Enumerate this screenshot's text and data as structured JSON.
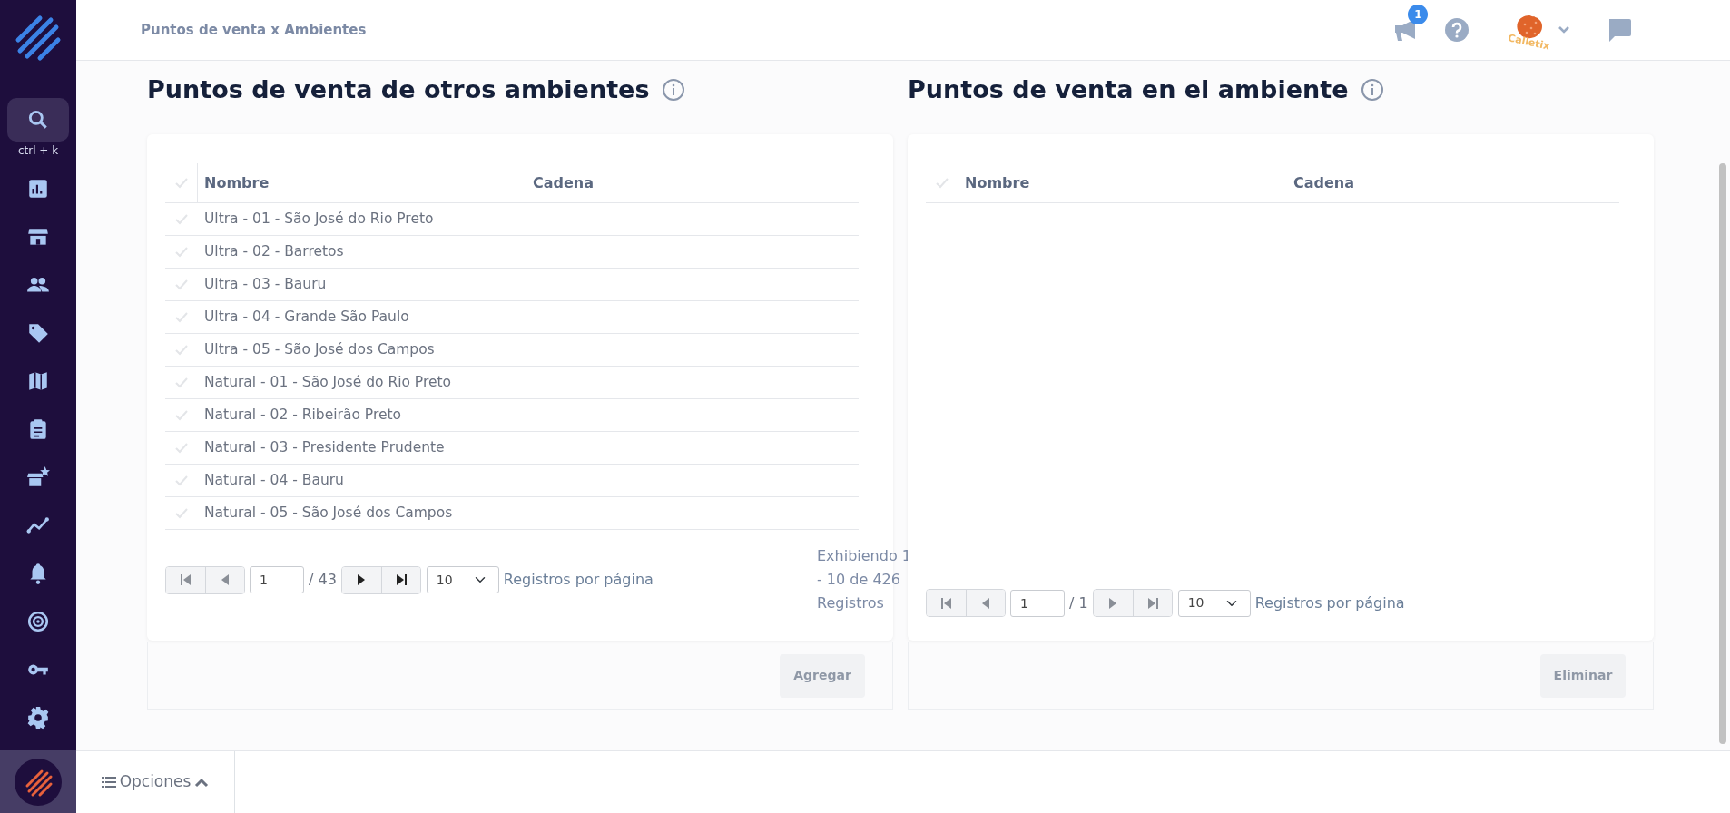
{
  "breadcrumb": "Puntos de venta x Ambientes",
  "topbar": {
    "notification_count": "1",
    "brand": "Calletix"
  },
  "sidebar": {
    "search_hint": "ctrl + k"
  },
  "panels": [
    {
      "title": "Puntos de venta de otros ambientes",
      "columns": [
        "Nombre",
        "Cadena"
      ],
      "rows": [
        {
          "name": "Ultra - 01 - São José do Rio Preto",
          "selected": false
        },
        {
          "name": "Ultra - 02 - Barretos",
          "selected": false
        },
        {
          "name": "Ultra - 03 - Bauru",
          "selected": false
        },
        {
          "name": "Ultra - 04 - Grande São Paulo",
          "selected": false
        },
        {
          "name": "Ultra - 05 - São José dos Campos",
          "selected": false
        },
        {
          "name": "Natural - 01 - São José do Rio Preto",
          "selected": false
        },
        {
          "name": "Natural - 02 - Ribeirão Preto",
          "selected": false
        },
        {
          "name": "Natural - 03 - Presidente Prudente",
          "selected": false
        },
        {
          "name": "Natural - 04 - Bauru",
          "selected": false
        },
        {
          "name": "Natural - 05 - São José dos Campos",
          "selected": false
        }
      ],
      "pager": {
        "page": "1",
        "total": "/ 43",
        "back_disabled": true,
        "forward_disabled": false,
        "page_size": "10",
        "per_page_label": "Registros por página",
        "summary": "Exhibiendo 1 - 10 de 426 Registros"
      },
      "action": {
        "label": "Agregar",
        "disabled": true
      }
    },
    {
      "title": "Puntos de venta en el ambiente",
      "columns": [
        "Nombre",
        "Cadena"
      ],
      "pager": {
        "page": "1",
        "total": "/ 1",
        "back_disabled": true,
        "forward_disabled": true,
        "page_size": "10",
        "per_page_label": "Registros por página"
      },
      "action": {
        "label": "Eliminar",
        "disabled": true
      }
    }
  ],
  "footer": {
    "options_label": "Opciones"
  }
}
